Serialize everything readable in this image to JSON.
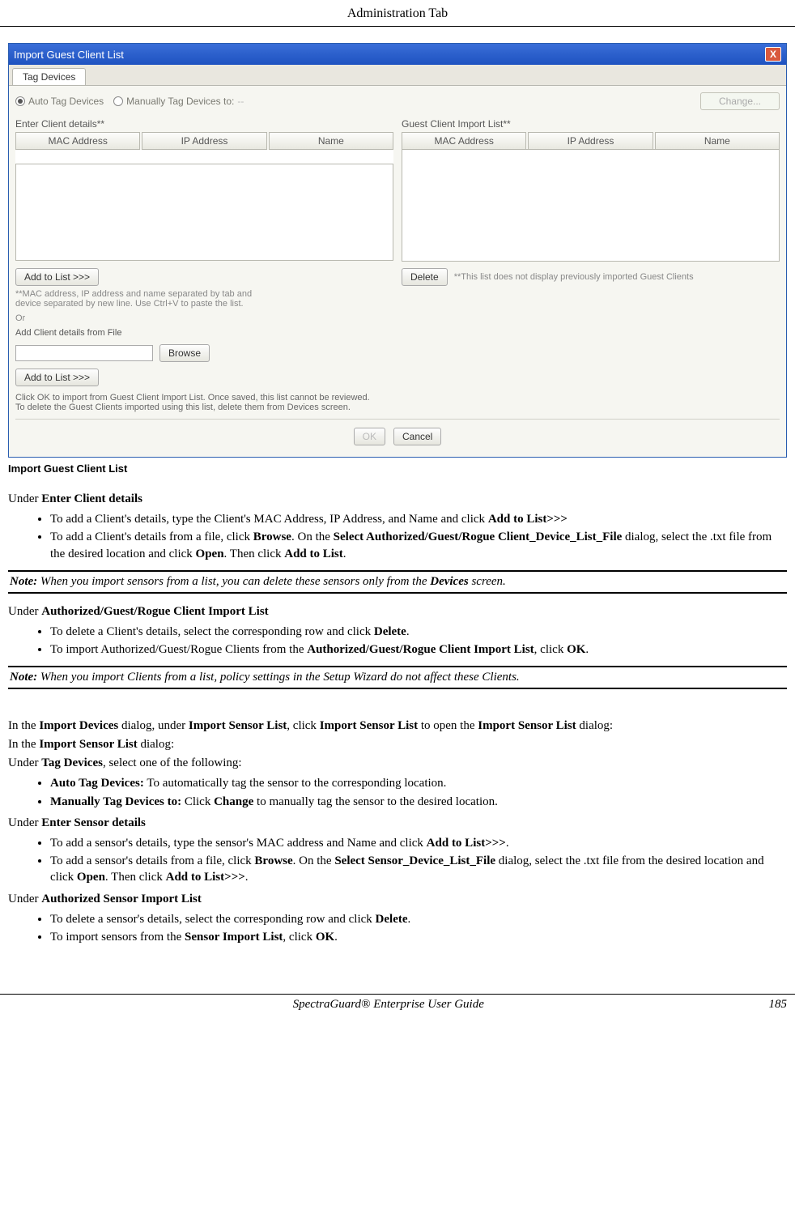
{
  "header": {
    "title": "Administration Tab"
  },
  "dialog": {
    "title": "Import Guest Client List",
    "close": "X",
    "tab": "Tag Devices",
    "radio_auto": "Auto Tag Devices",
    "radio_manual": "Manually Tag Devices to:",
    "manual_value": "--",
    "change_btn": "Change...",
    "left_label": "Enter Client details**",
    "right_label": "Guest Client Import List**",
    "col_mac": "MAC Address",
    "col_ip": "IP Address",
    "col_name": "Name",
    "add_to_list": "Add to List >>>",
    "delete_btn": "Delete",
    "delete_note": "**This list does not display previously imported Guest Clients",
    "mac_note": "**MAC address, IP address and name separated by tab and device separated by new line. Use Ctrl+V to paste the list.",
    "or": "Or",
    "add_file_label": "Add Client details from File",
    "browse": "Browse",
    "add_to_list2": "Add to List >>>",
    "bottom_note": "Click OK to import from Guest Client Import List. Once saved, this list cannot be reviewed.\nTo delete the Guest Clients imported using this list, delete them from Devices screen.",
    "ok": "OK",
    "cancel": "Cancel"
  },
  "caption": "Import Guest Client List",
  "s1": {
    "intro_pre": "Under ",
    "intro_bold": "Enter Client details",
    "b1_pre": " To add a Client's details, type the Client's MAC Address, IP Address, and Name and click ",
    "b1_bold": "Add to List>>>",
    "b2_1": "To add a Client's details from a file, click  ",
    "b2_b1": "Browse",
    "b2_2": ". On the ",
    "b2_b2": "Select Authorized/Guest/Rogue Client_Device_List_File",
    "b2_3": " dialog, select the .txt file from the desired location and click ",
    "b2_b3": "Open",
    "b2_4": ". Then click ",
    "b2_b4": "Add to List",
    "b2_5": "."
  },
  "note1": {
    "label": "Note:",
    "t1": " When you import sensors from a list, you can delete these sensors only from the ",
    "bold": "Devices",
    "t2": " screen."
  },
  "s2": {
    "intro_pre": "Under ",
    "intro_bold": "Authorized/Guest/Rogue Client Import List",
    "b1_1": "To delete a Client's details, select the corresponding row and click ",
    "b1_b": "Delete",
    "b1_2": ".",
    "b2_1": "To import Authorized/Guest/Rogue Clients from the ",
    "b2_b": "Authorized/Guest/Rogue Client Import List",
    "b2_2": ", click ",
    "b2_b2": "OK",
    "b2_3": "."
  },
  "note2": {
    "label": "Note:",
    "t": " When you import Clients from a list, policy settings in the Setup Wizard do not affect these Clients."
  },
  "p1": {
    "t1": "In the ",
    "b1": "Import Devices",
    "t2": " dialog, under ",
    "b2": "Import Sensor List",
    "t3": ", click ",
    "b3": "Import Sensor List",
    "t4": " to open the ",
    "b4": "Import Sensor List",
    "t5": " dialog:"
  },
  "p2": {
    "t1": "In the ",
    "b1": "Import Sensor List",
    "t2": " dialog:"
  },
  "p3": {
    "t1": "Under ",
    "b1": "Tag Devices",
    "t2": ", select one of the following:"
  },
  "s3": {
    "b1_b": "Auto Tag Devices:",
    "b1_t": " To automatically tag the sensor to the corresponding location.",
    "b2_b": "Manually Tag Devices to:",
    "b2_t1": " Click ",
    "b2_b2": "Change",
    "b2_t2": " to manually tag the sensor to the desired location."
  },
  "p4": {
    "t1": "Under ",
    "b1": "Enter Sensor details"
  },
  "s4": {
    "b1_1": "To add a sensor's details, type the sensor's MAC address and Name and click ",
    "b1_b": "Add to List>>>",
    "b1_2": ".",
    "b2_1": "To add a sensor's details from a file, click ",
    "b2_b1": "Browse",
    "b2_2": ". On the ",
    "b2_b2": "Select Sensor_Device_List_File",
    "b2_3": " dialog, select the .txt file from the desired location and click ",
    "b2_b3": "Open",
    "b2_4": ". Then click ",
    "b2_b4": "Add to List>>>",
    "b2_5": "."
  },
  "p5": {
    "t1": "Under ",
    "b1": "Authorized Sensor Import List"
  },
  "s5": {
    "b1_1": "To delete a sensor's details, select the corresponding row and click ",
    "b1_b": "Delete",
    "b1_2": ".",
    "b2_1": "To import sensors from the ",
    "b2_b": "Sensor Import List",
    "b2_2": ", click ",
    "b2_b2": "OK",
    "b2_3": "."
  },
  "footer": {
    "title": "SpectraGuard®  Enterprise User Guide",
    "page": "185"
  }
}
